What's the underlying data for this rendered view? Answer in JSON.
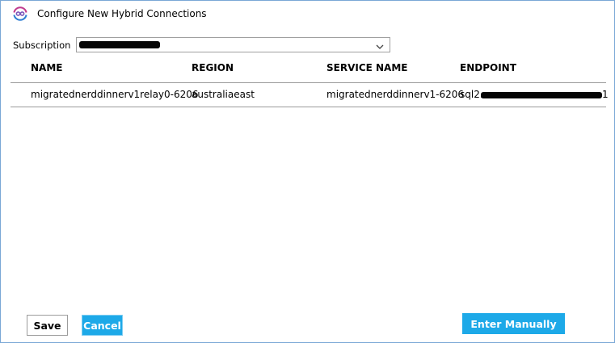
{
  "window": {
    "title": "Configure New Hybrid Connections",
    "icon": "hybrid-connection-icon"
  },
  "subscription": {
    "label": "Subscription",
    "value": "",
    "redacted": true
  },
  "table": {
    "columns": [
      "NAME",
      "REGION",
      "SERVICE NAME",
      "ENDPOINT"
    ],
    "rows": [
      {
        "name": "migratednerddinnerv1relay0-6206",
        "region": "australiaeast",
        "service_name": "migratednerddinnerv1-6206",
        "endpoint_prefix": "sql2.",
        "endpoint_suffix": "1",
        "endpoint_redacted": true
      }
    ]
  },
  "buttons": {
    "save": "Save",
    "cancel": "Cancel",
    "enter_manually": "Enter Manually"
  },
  "colors": {
    "accent": "#1da9e8",
    "window_border": "#7aa7d6",
    "rule": "#9a9a9a"
  }
}
